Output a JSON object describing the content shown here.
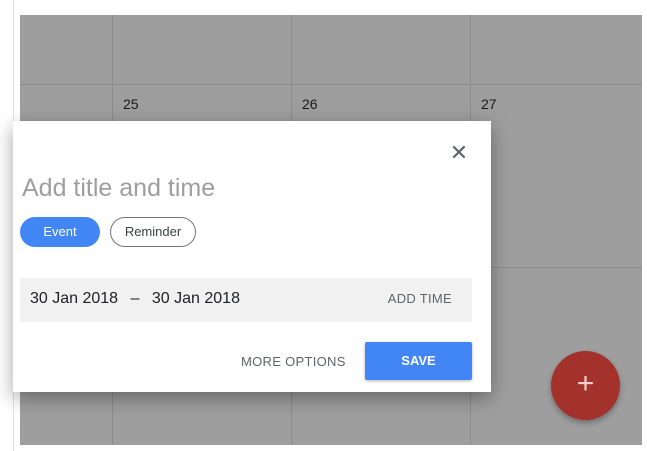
{
  "calendar": {
    "days": [
      "25",
      "26",
      "27"
    ]
  },
  "dialog": {
    "close_icon": "close-icon",
    "close_glyph": "✕",
    "title_placeholder": "Add title and time",
    "chips": {
      "event": "Event",
      "reminder": "Reminder"
    },
    "start_date": "30 Jan 2018",
    "separator": "–",
    "end_date": "30 Jan 2018",
    "add_time": "ADD TIME",
    "more_options": "MORE OPTIONS",
    "save": "SAVE"
  },
  "fab": {
    "icon": "plus-icon",
    "glyph": "+"
  },
  "colors": {
    "accent": "#4285f4",
    "fab": "#a3322c",
    "overlay": "#9e9e9e"
  }
}
